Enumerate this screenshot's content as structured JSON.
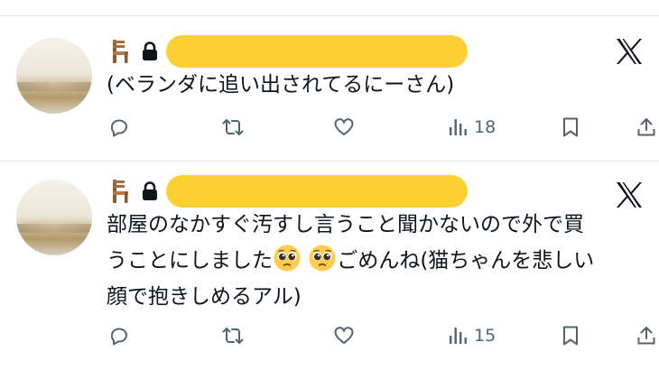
{
  "tweets": [
    {
      "name_emoji": "chair-icon",
      "protected_icon": "lock-icon",
      "text_lines": [
        "(ベランダに追い出されてるにーさん)"
      ],
      "views": "18"
    },
    {
      "name_emoji": "chair-icon",
      "protected_icon": "lock-icon",
      "text_line1": "部屋のなかすぐ汚すし言うこと聞かないので外で買",
      "text_line2_a": "うことにしました",
      "text_line2_b": "ごめんね(猫ちゃんを悲しい",
      "text_line3": "顔で抱きしめるアル)",
      "emoji": "pleading-face-emoji",
      "views": "15"
    }
  ],
  "colors": {
    "text": "#0f1419",
    "muted": "#536471",
    "divider": "#e6e9ec",
    "redaction": "#fcd034"
  }
}
